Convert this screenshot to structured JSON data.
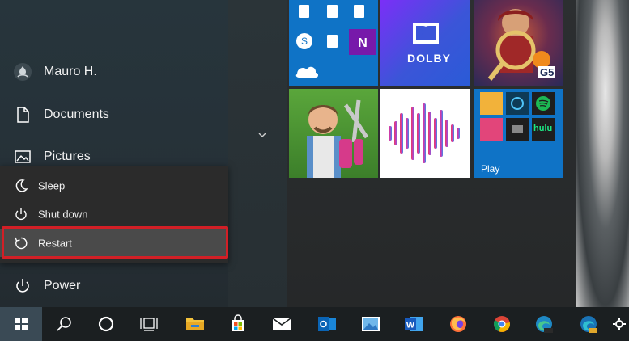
{
  "start_menu": {
    "user_name": "Mauro H.",
    "documents_label": "Documents",
    "pictures_label": "Pictures",
    "power_label": "Power"
  },
  "power_menu": {
    "sleep_label": "Sleep",
    "shutdown_label": "Shut down",
    "restart_label": "Restart"
  },
  "tiles": {
    "dolby_label": "DOLBY",
    "play_label": "Play",
    "hulu_label": "hulu",
    "g5_label": "G5"
  },
  "taskbar": {
    "word_label": "W",
    "outlook_label": "O"
  },
  "colors": {
    "accent_blue": "#0078d7",
    "dolby_gradient_start": "#7b2ff7",
    "dolby_gradient_end": "#2a5bd7",
    "restart_highlight": "#d21f26",
    "onenote_purple": "#7719aa"
  },
  "icons": {
    "user": "user-avatar-icon",
    "documents": "document-icon",
    "pictures": "pictures-icon",
    "power": "power-icon",
    "sleep": "moon-icon",
    "shutdown": "power-icon",
    "restart": "restart-icon",
    "start": "windows-logo-icon",
    "search": "search-icon",
    "cortana": "cortana-circle-icon",
    "task_view": "task-view-icon"
  }
}
